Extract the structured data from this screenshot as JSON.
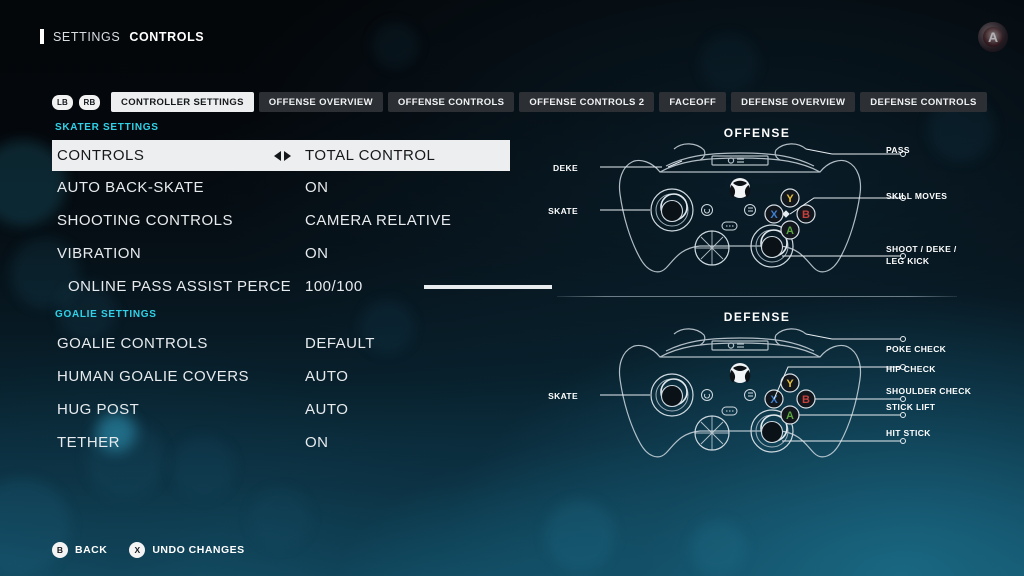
{
  "header": {
    "breadcrumb_prefix": "SETTINGS",
    "breadcrumb_current": "CONTROLS",
    "logo_glyph": "A"
  },
  "tabbar": {
    "bumper_left": "LB",
    "bumper_right": "RB",
    "tabs": [
      {
        "label": "CONTROLLER SETTINGS",
        "active": true
      },
      {
        "label": "OFFENSE OVERVIEW",
        "active": false
      },
      {
        "label": "OFFENSE CONTROLS",
        "active": false
      },
      {
        "label": "OFFENSE CONTROLS 2",
        "active": false
      },
      {
        "label": "FACEOFF",
        "active": false
      },
      {
        "label": "DEFENSE OVERVIEW",
        "active": false
      },
      {
        "label": "DEFENSE CONTROLS",
        "active": false
      }
    ]
  },
  "settings": {
    "skater_section_label": "SKATER SETTINGS",
    "goalie_section_label": "GOALIE SETTINGS",
    "skater_rows": [
      {
        "label": "CONTROLS",
        "value": "TOTAL CONTROL",
        "selected": true,
        "has_arrows": true,
        "indent": false,
        "slider": null
      },
      {
        "label": "AUTO BACK-SKATE",
        "value": "ON",
        "selected": false,
        "has_arrows": false,
        "indent": false,
        "slider": null
      },
      {
        "label": "SHOOTING CONTROLS",
        "value": "CAMERA RELATIVE",
        "selected": false,
        "has_arrows": false,
        "indent": false,
        "slider": null
      },
      {
        "label": "VIBRATION",
        "value": "ON",
        "selected": false,
        "has_arrows": false,
        "indent": false,
        "slider": null
      },
      {
        "label": "ONLINE PASS ASSIST PERCE",
        "value": "100/100",
        "selected": false,
        "has_arrows": false,
        "indent": true,
        "slider": 100
      }
    ],
    "goalie_rows": [
      {
        "label": "GOALIE CONTROLS",
        "value": "DEFAULT",
        "selected": false,
        "has_arrows": false,
        "indent": false,
        "slider": null
      },
      {
        "label": "HUMAN GOALIE COVERS",
        "value": "AUTO",
        "selected": false,
        "has_arrows": false,
        "indent": false,
        "slider": null
      },
      {
        "label": "HUG POST",
        "value": "AUTO",
        "selected": false,
        "has_arrows": false,
        "indent": false,
        "slider": null
      },
      {
        "label": "TETHER",
        "value": "ON",
        "selected": false,
        "has_arrows": false,
        "indent": false,
        "slider": null
      }
    ]
  },
  "diagrams": {
    "offense": {
      "title": "OFFENSE",
      "callouts": {
        "deke": "DEKE",
        "skate": "SKATE",
        "pass": "PASS",
        "skill_moves": "SKILL MOVES",
        "shoot": "SHOOT / DEKE /\nLEG KICK"
      }
    },
    "defense": {
      "title": "DEFENSE",
      "callouts": {
        "skate": "SKATE",
        "poke_check": "POKE CHECK",
        "hip_check": "HIP CHECK",
        "shoulder_check": "SHOULDER CHECK",
        "stick_lift": "STICK LIFT",
        "hit_stick": "HIT STICK"
      }
    },
    "face_buttons": {
      "y": "Y",
      "x": "X",
      "b": "B",
      "a": "A"
    }
  },
  "footer": {
    "buttons": [
      {
        "glyph": "B",
        "label": "BACK"
      },
      {
        "glyph": "X",
        "label": "UNDO CHANGES"
      }
    ]
  },
  "colors": {
    "accent_cyan": "#2fd2e8",
    "btn_y": "#e5bd3c",
    "btn_x": "#3f7fd0",
    "btn_b": "#c6403c",
    "btn_a": "#5aa63f",
    "panel_light": "#eceeef"
  }
}
